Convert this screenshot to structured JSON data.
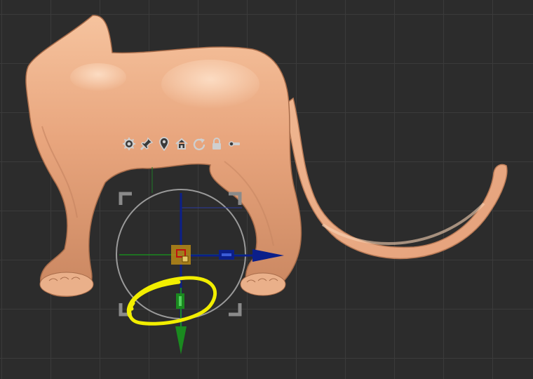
{
  "viewport": {
    "background_color": "#2c2c2c",
    "grid_color": "#3b3b3b"
  },
  "model": {
    "subject": "cat sculpt",
    "skin_color": "#e8a57d"
  },
  "gizmo": {
    "x_axis_color": "#0b1f8a",
    "y_axis_color": "#1a8a1f",
    "z_axis_color": "#0b1f8a",
    "ring_color": "#9a9a9a",
    "center_color": "#b88a16"
  },
  "annotation": {
    "highlight_color": "#f2ee00"
  },
  "toolbar": {
    "buttons": [
      {
        "icon": "gear-icon"
      },
      {
        "icon": "pin-icon"
      },
      {
        "icon": "location-marker-icon"
      },
      {
        "icon": "home-icon"
      },
      {
        "icon": "reset-icon"
      },
      {
        "icon": "lock-icon"
      },
      {
        "icon": "unlock-slider-icon"
      }
    ]
  }
}
